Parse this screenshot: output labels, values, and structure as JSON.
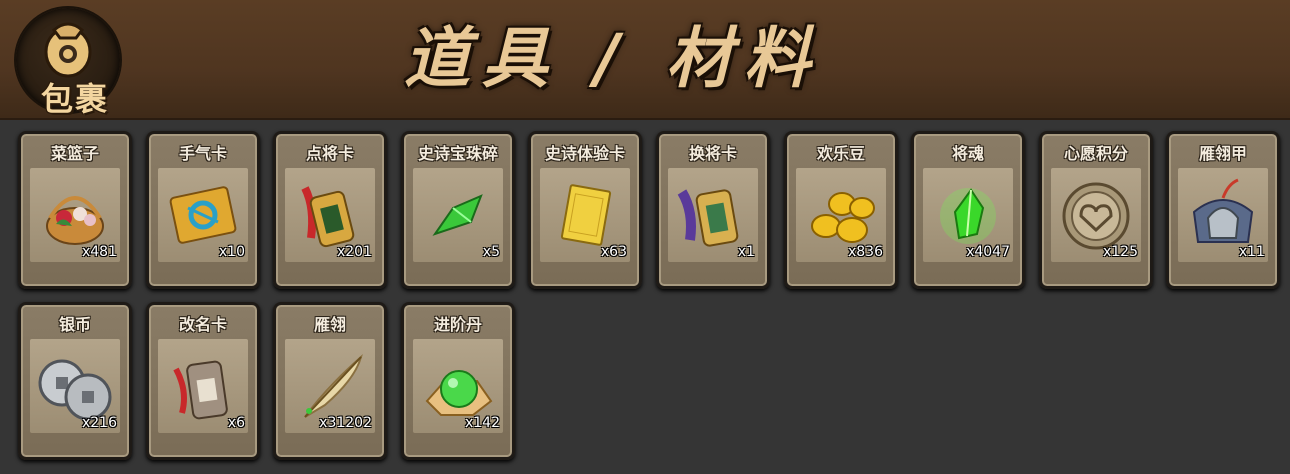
{
  "header": {
    "bag_label": "包裹",
    "title": "道具 / 材料"
  },
  "items": [
    {
      "name": "菜篮子",
      "count": "x481",
      "icon": "vegetable-basket-icon"
    },
    {
      "name": "手气卡",
      "count": "x10",
      "icon": "luck-card-icon"
    },
    {
      "name": "点将卡",
      "count": "x201",
      "icon": "general-pick-token-icon"
    },
    {
      "name": "史诗宝珠碎",
      "count": "x5",
      "icon": "green-gem-shard-icon"
    },
    {
      "name": "史诗体验卡",
      "count": "x63",
      "icon": "gold-card-icon"
    },
    {
      "name": "换将卡",
      "count": "x1",
      "icon": "swap-general-token-icon"
    },
    {
      "name": "欢乐豆",
      "count": "x836",
      "icon": "gold-beans-icon"
    },
    {
      "name": "将魂",
      "count": "x4047",
      "icon": "green-soul-crystal-icon"
    },
    {
      "name": "心愿积分",
      "count": "x125",
      "icon": "heart-coin-icon"
    },
    {
      "name": "雁翎甲",
      "count": "x11",
      "icon": "armor-helmet-icon"
    },
    {
      "name": "银币",
      "count": "x216",
      "icon": "silver-coins-icon"
    },
    {
      "name": "改名卡",
      "count": "x6",
      "icon": "rename-token-icon"
    },
    {
      "name": "雁翎",
      "count": "x31202",
      "icon": "feather-quill-icon"
    },
    {
      "name": "进阶丹",
      "count": "x142",
      "icon": "green-pill-icon"
    }
  ]
}
